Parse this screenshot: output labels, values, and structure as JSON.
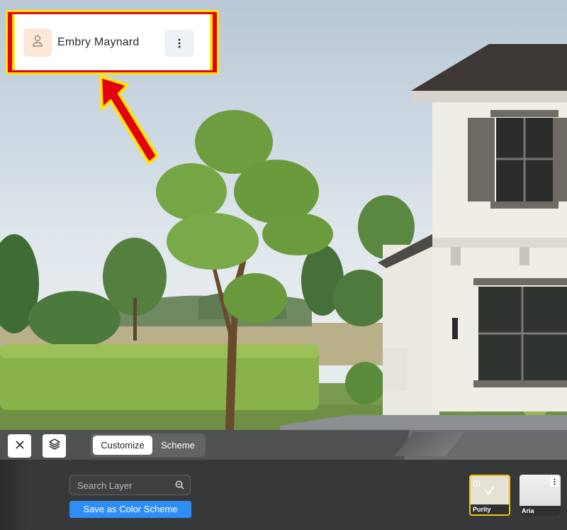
{
  "user": {
    "name": "Embry Maynard",
    "avatar_icon": "person-icon",
    "menu_icon": "vertical-dots-icon"
  },
  "toolbar": {
    "close_icon": "close-icon",
    "layers_icon": "layers-icon",
    "tabs": [
      {
        "label": "Customize",
        "active": true
      },
      {
        "label": "Scheme",
        "active": false
      }
    ]
  },
  "panel": {
    "search_placeholder": "Search Layer",
    "search_icon": "search-icon",
    "save_button": "Save as Color Scheme",
    "swatches": [
      {
        "label": "Purity",
        "selected": true,
        "color": "#e6e1d5"
      },
      {
        "label": "Aria",
        "selected": false,
        "color": "#e5e5e5"
      }
    ]
  },
  "colors": {
    "highlight_yellow": "#ffe600",
    "highlight_red": "#e3000f",
    "accent_blue": "#2e8ef5",
    "toolbar_gray": "#505153"
  }
}
